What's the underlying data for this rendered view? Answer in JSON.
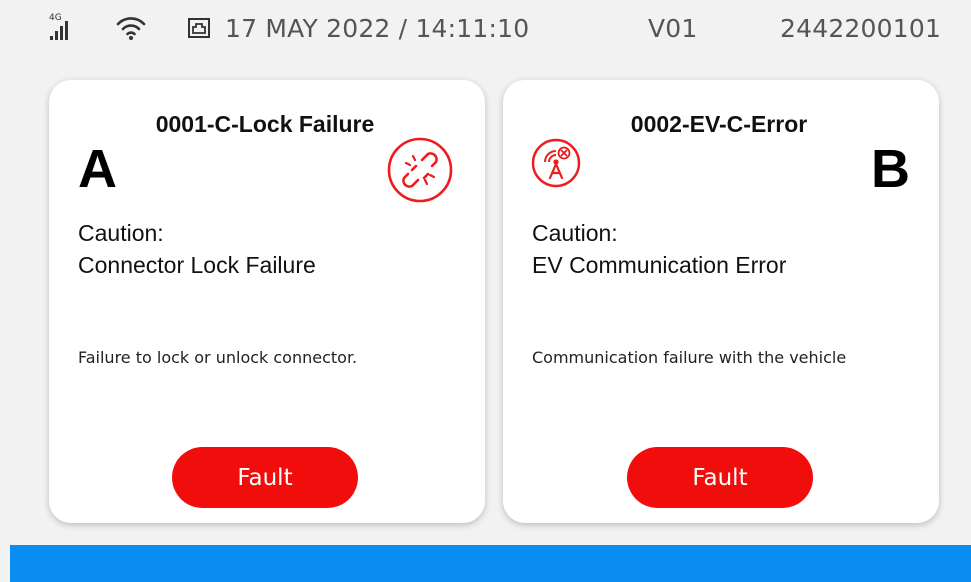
{
  "statusbar": {
    "network_label": "4G",
    "datetime": "17 MAY 2022 / 14:11:10",
    "version": "V01",
    "serial": "2442200101",
    "icons": [
      "signal-4g-icon",
      "wifi-icon",
      "ethernet-icon"
    ]
  },
  "cards": [
    {
      "code_title": "0001-C-Lock Failure",
      "connector": "A",
      "icon": "broken-link-icon",
      "caution_label": "Caution:",
      "caution_text": "Connector Lock Failure",
      "description": "Failure to lock or unlock connector.",
      "button_label": "Fault"
    },
    {
      "code_title": "0002-EV-C-Error",
      "connector": "B",
      "icon": "communication-error-icon",
      "caution_label": "Caution:",
      "caution_text": "EV Communication Error",
      "description": "Communication failure with the vehicle",
      "button_label": "Fault"
    }
  ],
  "colors": {
    "accent_red": "#f20d0d",
    "bottom_bar_blue": "#0a8cf0",
    "background": "#f2f2f2"
  }
}
